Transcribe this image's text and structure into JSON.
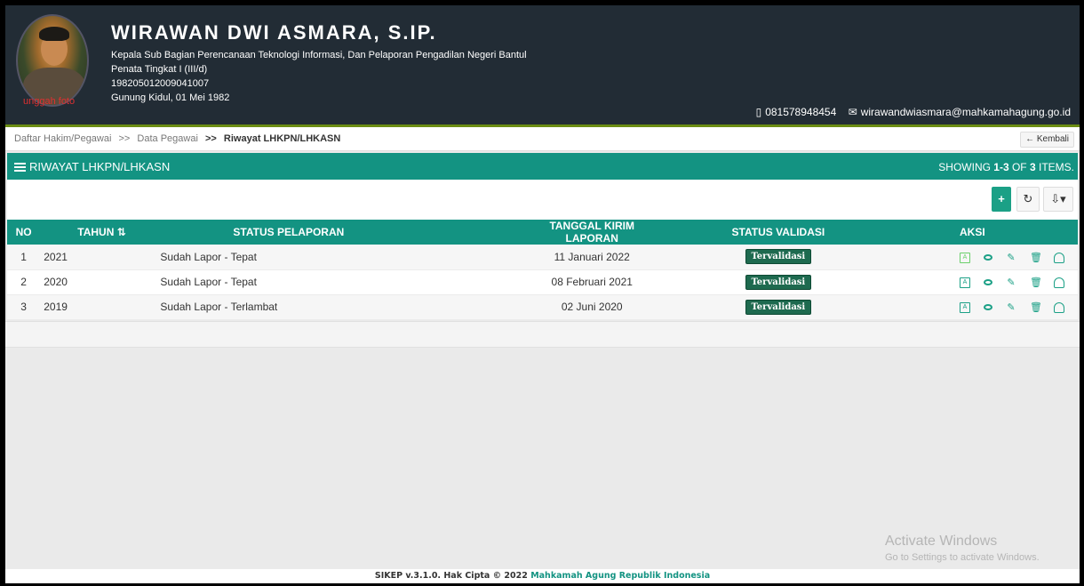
{
  "profile": {
    "upload_label": "unggah foto",
    "name": "WIRAWAN DWI ASMARA, S.IP.",
    "position": "Kepala Sub Bagian Perencanaan Teknologi Informasi, Dan Pelaporan Pengadilan Negeri Bantul",
    "rank": "Penata Tingkat I (III/d)",
    "nip": "198205012009041007",
    "birth": "Gunung Kidul, 01 Mei 1982",
    "phone": "081578948454",
    "email": "wirawandwiasmara@mahkamahagung.go.id"
  },
  "breadcrumb": {
    "items": [
      "Daftar Hakim/Pegawai",
      "Data Pegawai",
      "Riwayat LHKPN/LHKASN"
    ],
    "separator": ">>",
    "back_label": "Kembali"
  },
  "panel": {
    "title": "RIWAYAT LHKPN/LHKASN",
    "showing_prefix": "SHOWING ",
    "showing_range": "1-3",
    "showing_of": " OF ",
    "showing_total": "3",
    "showing_suffix": " ITEMS."
  },
  "toolbar": {
    "add": "+",
    "refresh": "↻",
    "export": "⇩▾"
  },
  "table": {
    "headers": [
      "NO",
      "TAHUN ⇅",
      "STATUS PELAPORAN",
      "TANGGAL KIRIM LAPORAN",
      "STATUS VALIDASI",
      "AKSI"
    ],
    "rows": [
      {
        "no": "1",
        "year": "2021",
        "status": "Sudah Lapor - Tepat",
        "date": "11 Januari 2022",
        "validation": "Tervalidasi"
      },
      {
        "no": "2",
        "year": "2020",
        "status": "Sudah Lapor - Tepat",
        "date": "08 Februari 2021",
        "validation": "Tervalidasi"
      },
      {
        "no": "3",
        "year": "2019",
        "status": "Sudah Lapor - Terlambat",
        "date": "02 Juni 2020",
        "validation": "Tervalidasi"
      }
    ]
  },
  "watermark": {
    "title": "Activate Windows",
    "subtitle": "Go to Settings to activate Windows."
  },
  "footer": {
    "text": "SIKEP v.3.1.0. Hak Cipta © 2022 ",
    "brand": "Mahkamah Agung Republik Indonesia"
  },
  "colors": {
    "header_bg": "#222c35",
    "accent": "#139382",
    "badge": "#1e6a4f",
    "upload_link": "#e03030"
  }
}
